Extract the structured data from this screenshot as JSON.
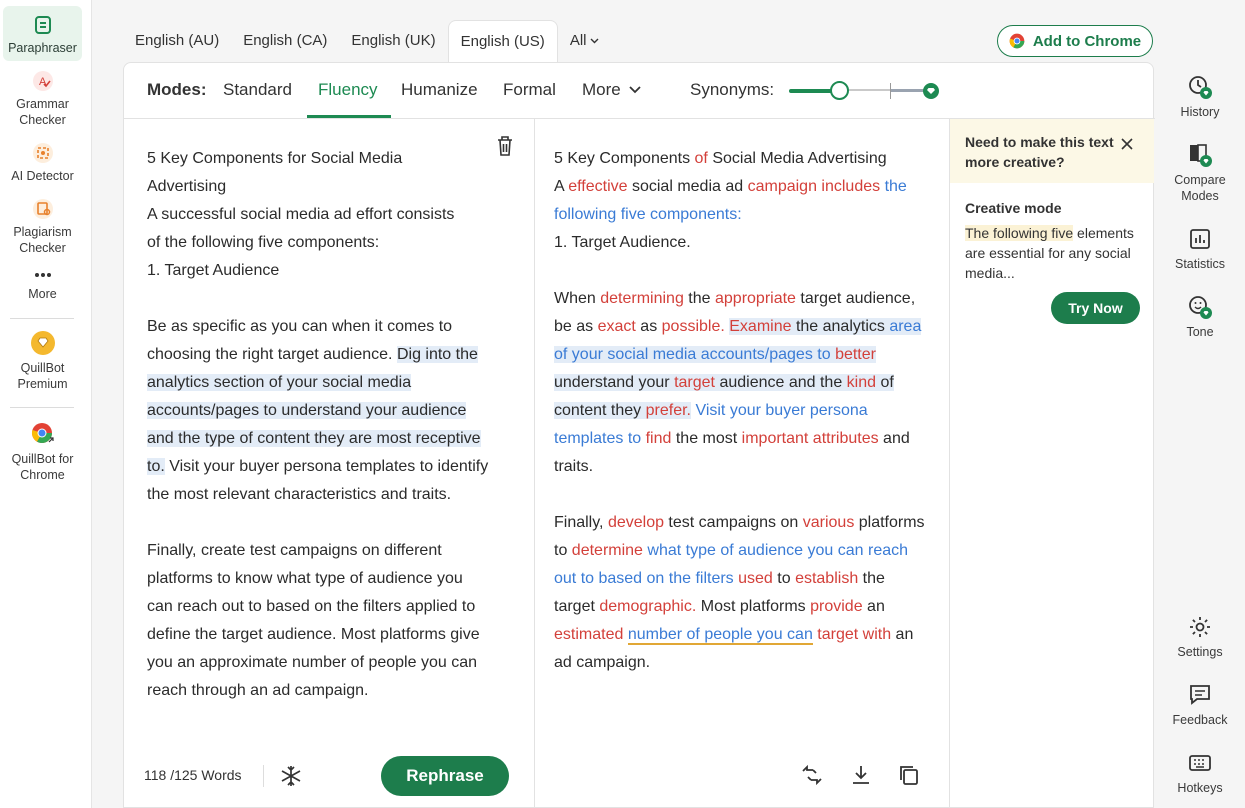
{
  "left_sidebar": {
    "items": [
      {
        "label": "Paraphraser",
        "icon": "paraphraser-icon"
      },
      {
        "label": "Grammar Checker",
        "icon": "grammar-checker-icon"
      },
      {
        "label": "AI Detector",
        "icon": "ai-detector-icon"
      },
      {
        "label": "Plagiarism Checker",
        "icon": "plagiarism-checker-icon"
      },
      {
        "label": "More",
        "icon": "more-dots-icon"
      },
      {
        "label": "QuillBot Premium",
        "icon": "premium-diamond-icon"
      },
      {
        "label": "QuillBot for Chrome",
        "icon": "chrome-icon"
      }
    ]
  },
  "language_tabs": [
    "English (AU)",
    "English (CA)",
    "English (UK)",
    "English (US)",
    "All"
  ],
  "active_language": "English (US)",
  "add_to_chrome": "Add to Chrome",
  "modes": {
    "label": "Modes:",
    "items": [
      "Standard",
      "Fluency",
      "Humanize",
      "Formal",
      "More"
    ],
    "active": "Fluency",
    "synonyms_label": "Synonyms:"
  },
  "input": {
    "title": "5 Key Components for Social Media",
    "title2": "Advertising",
    "lines": [
      "A successful social media ad effort consists",
      "of the following five components:",
      "1. Target Audience"
    ],
    "p2_a": "Be as specific as you can when it comes to choosing the right target audience. ",
    "p2_hl": "Dig into the analytics section of your social media accounts/pages to understand your audience and the type of content they are most receptive to.",
    "p2_b": " Visit your buyer persona templates to identify the most relevant characteristics and traits.",
    "p3": "Finally, create test campaigns on different platforms to know what type of audience you can reach out to based on the filters applied to define the target audience. Most platforms give you an approximate number of people you can reach through an ad campaign."
  },
  "output": {
    "t1": "5 Key Components ",
    "t2": "of",
    "t3": " Social Media Advertising",
    "l2a": "A ",
    "l2b": "effective",
    "l2c": " social media ad ",
    "l2d": "campaign includes",
    "l2e": " ",
    "l2f": "the following five components:",
    "l3": "1. Target Audience.",
    "p2": [
      {
        "t": "When ",
        "c": ""
      },
      {
        "t": "determining",
        "c": "r"
      },
      {
        "t": " the ",
        "c": ""
      },
      {
        "t": "appropriate",
        "c": "r"
      },
      {
        "t": " target audience, be as ",
        "c": ""
      },
      {
        "t": "exact",
        "c": "r"
      },
      {
        "t": " as ",
        "c": ""
      },
      {
        "t": "possible.",
        "c": "r"
      },
      {
        "t": " ",
        "c": ""
      },
      {
        "t": "Examine",
        "c": "r hl"
      },
      {
        "t": " the analytics ",
        "c": "hl"
      },
      {
        "t": "area of your social media accounts/pages to",
        "c": "b hl"
      },
      {
        "t": " ",
        "c": "hl"
      },
      {
        "t": "better",
        "c": "r hl"
      },
      {
        "t": " understand your ",
        "c": "hl"
      },
      {
        "t": "target",
        "c": "r hl"
      },
      {
        "t": " audience and the ",
        "c": "hl"
      },
      {
        "t": "kind",
        "c": "r hl"
      },
      {
        "t": " of content they ",
        "c": "hl"
      },
      {
        "t": "prefer.",
        "c": "r hl"
      },
      {
        "t": " ",
        "c": ""
      },
      {
        "t": "Visit your buyer persona templates to",
        "c": "b"
      },
      {
        "t": " ",
        "c": ""
      },
      {
        "t": "find",
        "c": "r"
      },
      {
        "t": " the most ",
        "c": ""
      },
      {
        "t": "important attributes",
        "c": "r"
      },
      {
        "t": " and traits.",
        "c": ""
      }
    ],
    "p3": [
      {
        "t": "Finally, ",
        "c": ""
      },
      {
        "t": "develop",
        "c": "r"
      },
      {
        "t": " test campaigns on ",
        "c": ""
      },
      {
        "t": "various",
        "c": "r"
      },
      {
        "t": " platforms to ",
        "c": ""
      },
      {
        "t": "determine",
        "c": "r"
      },
      {
        "t": " ",
        "c": ""
      },
      {
        "t": "what type of audience you can reach out to based on the filters",
        "c": "b"
      },
      {
        "t": " ",
        "c": ""
      },
      {
        "t": "used",
        "c": "r"
      },
      {
        "t": " to ",
        "c": ""
      },
      {
        "t": "establish",
        "c": "r"
      },
      {
        "t": " the target ",
        "c": ""
      },
      {
        "t": "demographic.",
        "c": "r"
      },
      {
        "t": " Most platforms ",
        "c": ""
      },
      {
        "t": "provide",
        "c": "r"
      },
      {
        "t": " an ",
        "c": ""
      },
      {
        "t": "estimated",
        "c": "r"
      },
      {
        "t": " ",
        "c": ""
      },
      {
        "t": "number of people you can",
        "c": "b ul"
      },
      {
        "t": " ",
        "c": ""
      },
      {
        "t": "target with",
        "c": "r"
      },
      {
        "t": " an ad campaign.",
        "c": ""
      }
    ]
  },
  "footer": {
    "word_count": "118 /125 Words",
    "rephrase": "Rephrase"
  },
  "creative_panel": {
    "title": "Need to make this text more creative?",
    "mode_title": "Creative mode",
    "text_hl": "The following five",
    "text_rest": " elements are essential for any social media...",
    "try_now": "Try Now"
  },
  "right_sidebar": {
    "items": [
      {
        "label": "History",
        "icon": "history-icon"
      },
      {
        "label": "Compare Modes",
        "icon": "compare-modes-icon"
      },
      {
        "label": "Statistics",
        "icon": "statistics-icon"
      },
      {
        "label": "Tone",
        "icon": "tone-icon"
      },
      {
        "label": "Settings",
        "icon": "settings-gear-icon"
      },
      {
        "label": "Feedback",
        "icon": "feedback-icon"
      },
      {
        "label": "Hotkeys",
        "icon": "hotkeys-keyboard-icon"
      }
    ]
  },
  "colors": {
    "brand_green": "#1d7d4c",
    "changed_word_red": "#d3403a",
    "structural_change_blue": "#3a7bd5",
    "sentence_highlight": "#e3ecf7",
    "creative_banner": "#fcf8e6"
  }
}
